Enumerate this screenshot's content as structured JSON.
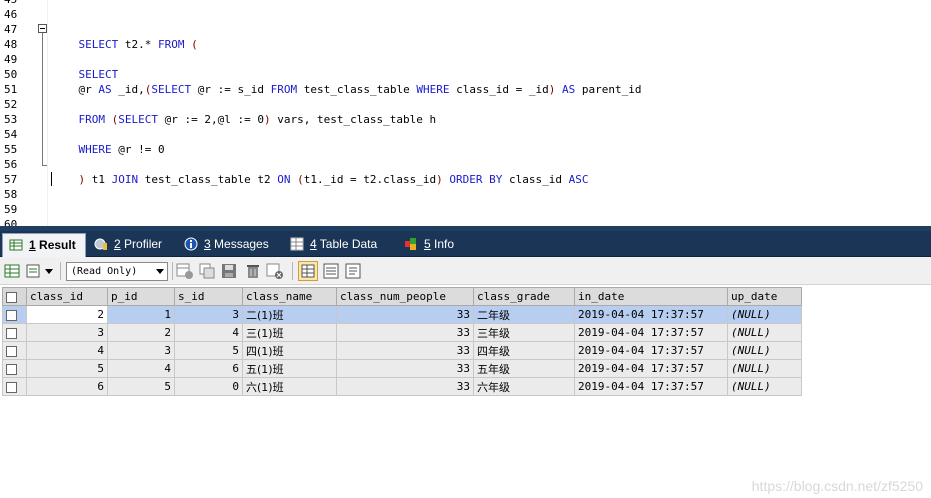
{
  "editor": {
    "line_numbers": [
      "45",
      "46",
      "47",
      "48",
      "49",
      "50",
      "51",
      "52",
      "53",
      "54",
      "55",
      "56",
      "57",
      "58",
      "59",
      "60"
    ],
    "lines": {
      "l47": [
        "SELECT",
        " t2.* ",
        "FROM",
        " ("
      ],
      "l49": [
        "SELECT"
      ],
      "l50": [
        "@r ",
        "AS",
        " _id,",
        "(",
        "SELECT",
        " @r := s_id ",
        "FROM",
        " test_class_table ",
        "WHERE",
        " class_id = _id",
        ")",
        " ",
        "AS",
        " parent_id"
      ],
      "l52": [
        "FROM",
        " ",
        "(",
        "SELECT",
        " @r := 2,@l := 0",
        ")",
        " vars, test_class_table h"
      ],
      "l54": [
        "WHERE",
        " @r != 0"
      ],
      "l56": [
        ")",
        " t1 ",
        "JOIN",
        " test_class_table t2 ",
        "ON",
        " ",
        "(",
        "t1._id = t2.class_id",
        ")",
        " ",
        "ORDER BY",
        " class_id ",
        "ASC"
      ]
    }
  },
  "tabs": [
    {
      "num": "1",
      "label": " Result",
      "icon": "result-grid-icon"
    },
    {
      "num": "2",
      "label": " Profiler",
      "icon": "profiler-icon"
    },
    {
      "num": "3",
      "label": " Messages",
      "icon": "messages-icon"
    },
    {
      "num": "4",
      "label": " Table Data",
      "icon": "table-data-icon"
    },
    {
      "num": "5",
      "label": " Info",
      "icon": "info-icon"
    }
  ],
  "toolbar": {
    "mode_select": "(Read Only)"
  },
  "grid": {
    "columns": [
      "class_id",
      "p_id",
      "s_id",
      "class_name",
      "class_num_people",
      "class_grade",
      "in_date",
      "up_date"
    ],
    "rows": [
      [
        "2",
        "1",
        "3",
        "二(1)班",
        "33",
        "二年级",
        "2019-04-04 17:37:57",
        "(NULL)"
      ],
      [
        "3",
        "2",
        "4",
        "三(1)班",
        "33",
        "三年级",
        "2019-04-04 17:37:57",
        "(NULL)"
      ],
      [
        "4",
        "3",
        "5",
        "四(1)班",
        "33",
        "四年级",
        "2019-04-04 17:37:57",
        "(NULL)"
      ],
      [
        "5",
        "4",
        "6",
        "五(1)班",
        "33",
        "五年级",
        "2019-04-04 17:37:57",
        "(NULL)"
      ],
      [
        "6",
        "5",
        "0",
        "六(1)班",
        "33",
        "六年级",
        "2019-04-04 17:37:57",
        "(NULL)"
      ]
    ]
  },
  "watermark": "https://blog.csdn.net/zf5250",
  "colors": {
    "keyword": "#1a1acd",
    "tabbar": "#1a3556",
    "selected_row": "#b8cef0"
  }
}
